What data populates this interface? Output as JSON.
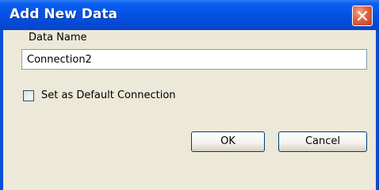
{
  "window": {
    "title": "Add New Data",
    "close_icon": "close-icon"
  },
  "form": {
    "data_name_label": "Data Name",
    "data_name_value": "Connection2",
    "default_checkbox_label": "Set as Default Connection",
    "default_checkbox_checked": false
  },
  "buttons": {
    "ok_label": "OK",
    "cancel_label": "Cancel"
  },
  "colors": {
    "titlebar": "#0553e6",
    "client": "#ece9d8",
    "close": "#e0623e"
  }
}
